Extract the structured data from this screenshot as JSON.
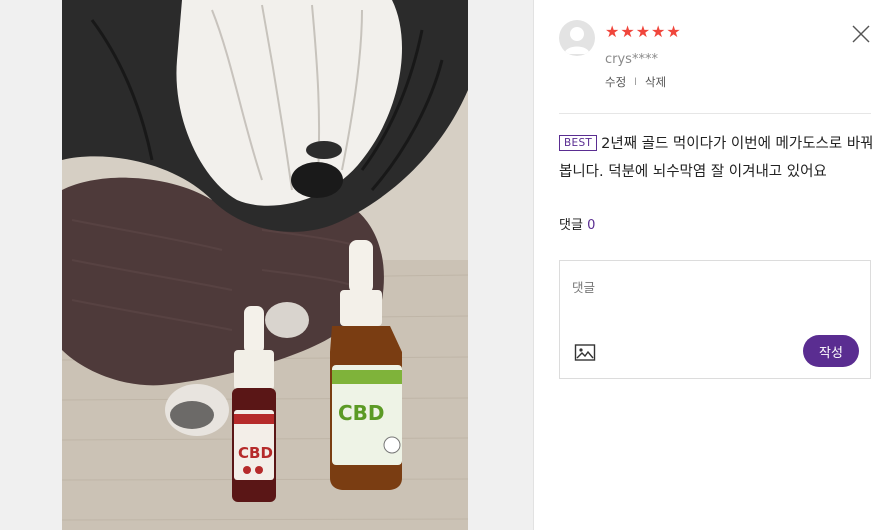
{
  "review": {
    "rating_stars": 5,
    "star_glyph": "★",
    "author": "crys****",
    "edit_label": "수정",
    "separator": "l",
    "delete_label": "삭제",
    "badge": "BEST",
    "text": "2년째 골드 먹이다가 이번에 메가도스로 바꿔봅니다. 덕분에 뇌수막염 잘 이겨내고 있어요"
  },
  "comments": {
    "label": "댓글",
    "count": "0",
    "placeholder": "댓글",
    "submit_label": "작성"
  },
  "photo": {
    "small_bottle_label": "CBD",
    "large_bottle_label": "CBD"
  },
  "colors": {
    "accent": "#5a2d91",
    "star": "#f0463c"
  },
  "icons": {
    "close": "close-icon",
    "image": "image-icon",
    "avatar": "user-avatar-icon"
  }
}
